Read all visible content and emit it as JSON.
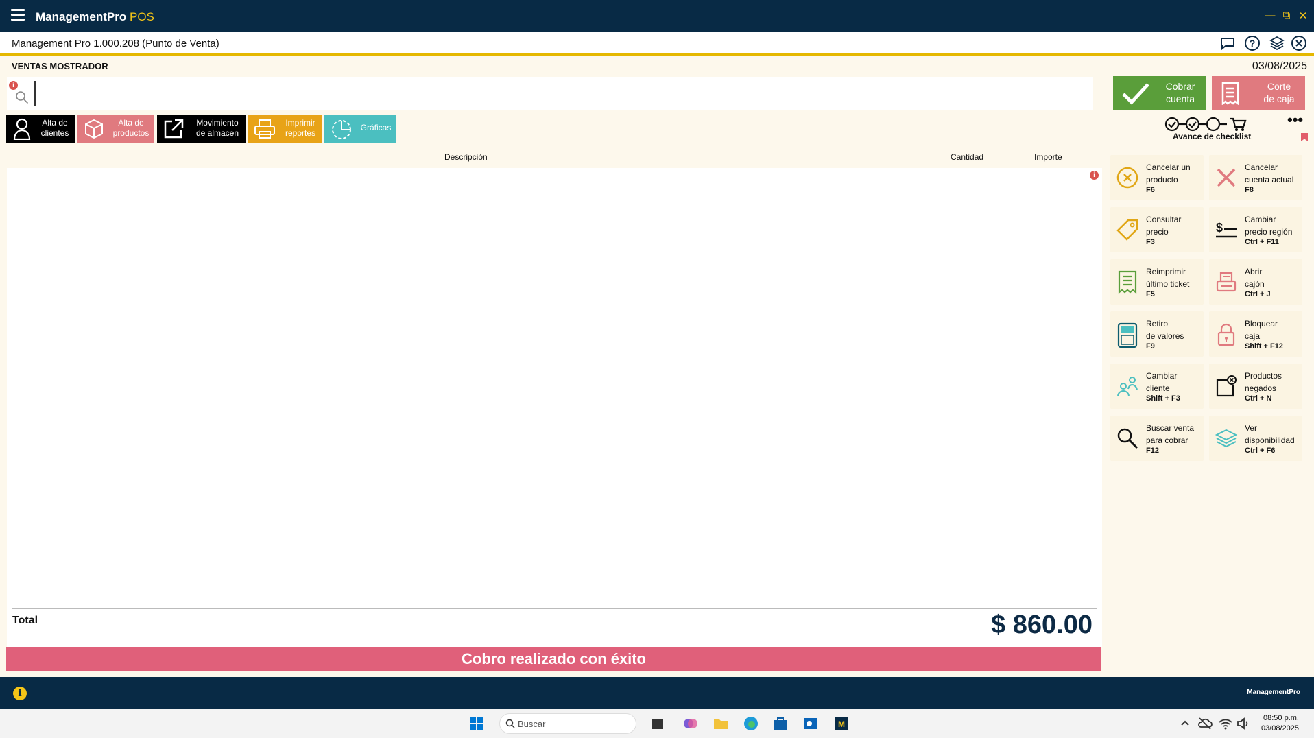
{
  "app": {
    "title": "ManagementPro",
    "title_suffix": "POS",
    "version_label": "Management Pro 1.000.208 (Punto de Venta)"
  },
  "header": {
    "section": "VENTAS MOSTRADOR",
    "date": "03/08/2025"
  },
  "search": {
    "value": "",
    "placeholder": ""
  },
  "actions": {
    "cobrar": {
      "line1": "Cobrar",
      "line2": "cuenta"
    },
    "corte": {
      "line1": "Corte",
      "line2": "de caja"
    }
  },
  "toolbar": [
    {
      "line1": "Alta de",
      "line2": "clientes"
    },
    {
      "line1": "Alta de",
      "line2": "productos"
    },
    {
      "line1": "Movimiento",
      "line2": "de almacen"
    },
    {
      "line1": "Imprimir",
      "line2": "reportes"
    },
    {
      "line1": "Gráficas",
      "line2": ""
    }
  ],
  "checklist": {
    "label": "Avance de checklist"
  },
  "table": {
    "columns": {
      "description": "Descripción",
      "quantity": "Cantidad",
      "amount": "Importe"
    },
    "rows": []
  },
  "total": {
    "label": "Total",
    "value": "$ 860.00"
  },
  "message": "Cobro realizado con éxito",
  "side_actions": [
    {
      "line1": "Cancelar un",
      "line2": "producto",
      "key": "F6"
    },
    {
      "line1": "Cancelar",
      "line2": "cuenta actual",
      "key": "F8"
    },
    {
      "line1": "Consultar",
      "line2": "precio",
      "key": "F3"
    },
    {
      "line1": "Cambiar",
      "line2": "precio región",
      "key": "Ctrl + F11"
    },
    {
      "line1": "Reimprimir",
      "line2": "último ticket",
      "key": "F5"
    },
    {
      "line1": "Abrir",
      "line2": "cajón",
      "key": "Ctrl + J"
    },
    {
      "line1": "Retiro",
      "line2": "de valores",
      "key": "F9"
    },
    {
      "line1": "Bloquear",
      "line2": "caja",
      "key": "Shift + F12"
    },
    {
      "line1": "Cambiar",
      "line2": "cliente",
      "key": "Shift + F3"
    },
    {
      "line1": "Productos",
      "line2": "negados",
      "key": "Ctrl + N"
    },
    {
      "line1": "Buscar venta",
      "line2": "para cobrar",
      "key": "F12"
    },
    {
      "line1": "Ver",
      "line2": "disponibilidad",
      "key": "Ctrl + F6"
    }
  ],
  "statusbar": {
    "brand": "ManagementPro"
  },
  "taskbar": {
    "search_placeholder": "Buscar",
    "time": "08:50 p.m.",
    "date": "03/08/2025"
  },
  "colors": {
    "navy": "#082a45",
    "accent_yellow": "#e5b800",
    "green": "#5a9e3a",
    "pink": "#e07a7f",
    "orange": "#e8a317",
    "teal": "#4bbfc0",
    "success_bar": "#e0607a"
  }
}
